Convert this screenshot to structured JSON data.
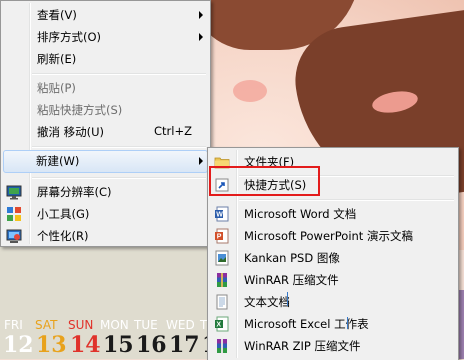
{
  "main_menu": {
    "items": [
      {
        "label": "查看(V)",
        "submenu": true
      },
      {
        "label": "排序方式(O)",
        "submenu": true
      },
      {
        "label": "刷新(E)"
      },
      {
        "label": "粘贴(P)",
        "disabled": true
      },
      {
        "label": "粘贴快捷方式(S)",
        "disabled": true
      },
      {
        "label": "撤消 移动(U)",
        "shortcut": "Ctrl+Z"
      },
      {
        "label": "新建(W)",
        "submenu": true,
        "highlighted": true
      },
      {
        "label": "屏幕分辨率(C)",
        "icon": "display-icon"
      },
      {
        "label": "小工具(G)",
        "icon": "gadgets-icon"
      },
      {
        "label": "个性化(R)",
        "icon": "personalize-icon"
      }
    ]
  },
  "new_submenu": {
    "items": [
      {
        "label": "文件夹(F)",
        "icon": "folder-icon"
      },
      {
        "label": "快捷方式(S)",
        "icon": "shortcut-icon"
      },
      {
        "label": "Microsoft Word 文档",
        "icon": "word-doc-icon"
      },
      {
        "label": "Microsoft PowerPoint 演示文稿",
        "icon": "powerpoint-icon"
      },
      {
        "label": "Kankan PSD 图像",
        "icon": "psd-image-icon"
      },
      {
        "label": "WinRAR 压缩文件",
        "icon": "winrar-icon"
      },
      {
        "label": "文本文档",
        "icon": "text-document-icon"
      },
      {
        "label": "Microsoft Excel 工作表",
        "icon": "excel-icon"
      },
      {
        "label": "WinRAR ZIP 压缩文件",
        "icon": "winrar-zip-icon"
      }
    ]
  },
  "calendar": {
    "days": [
      "FRI",
      "SAT",
      "SUN",
      "MON",
      "TUE",
      "WED",
      "T"
    ],
    "dates": [
      "12",
      "13",
      "14",
      "15",
      "16",
      "17",
      "1"
    ],
    "colors": {
      "weekday": "#ffffff",
      "sat": "#e8a21c",
      "sun": "#e0322b"
    }
  },
  "accent_colors": {
    "highlight_box": "#e31b1b",
    "menu_bg": "#f0f0f0"
  }
}
